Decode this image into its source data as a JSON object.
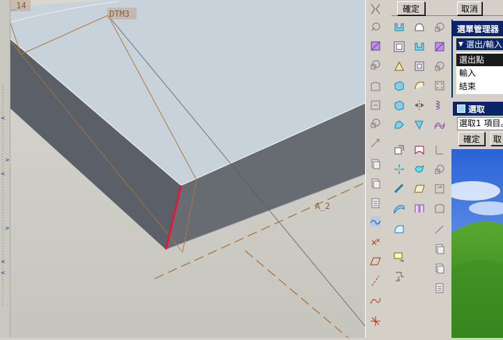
{
  "viewport": {
    "labels": {
      "top_left": "_14",
      "datum_plane": "DTM3",
      "axis": "A_2"
    }
  },
  "dialog_top": {
    "ok_label": "確定",
    "cancel_label": "取消"
  },
  "menu_manager": {
    "title": "選單管理器",
    "submenu_title": "選出/輸入",
    "items": [
      "選出點",
      "輸入",
      "結束"
    ]
  },
  "select_panel": {
    "title": "選取",
    "status": "選取1 項目。",
    "ok_label": "確定",
    "cancel_label": "取"
  },
  "icons": {
    "toolbar_primary": [
      "datum-plane-icon",
      "datum-axis-icon",
      "datum-curve-icon",
      "datum-point-icon",
      "coord-sys-icon",
      "analysis-icon",
      "sketch-icon",
      "copy-icon",
      "paste-icon",
      "selection-icon"
    ],
    "toolbar_secondary": [
      "extrude-icon",
      "revolve-icon",
      "sweep-icon",
      "blend-icon",
      "hole-icon",
      "shell-icon",
      "rib-icon",
      "draft-icon",
      "round-icon",
      "chamfer-icon"
    ]
  }
}
